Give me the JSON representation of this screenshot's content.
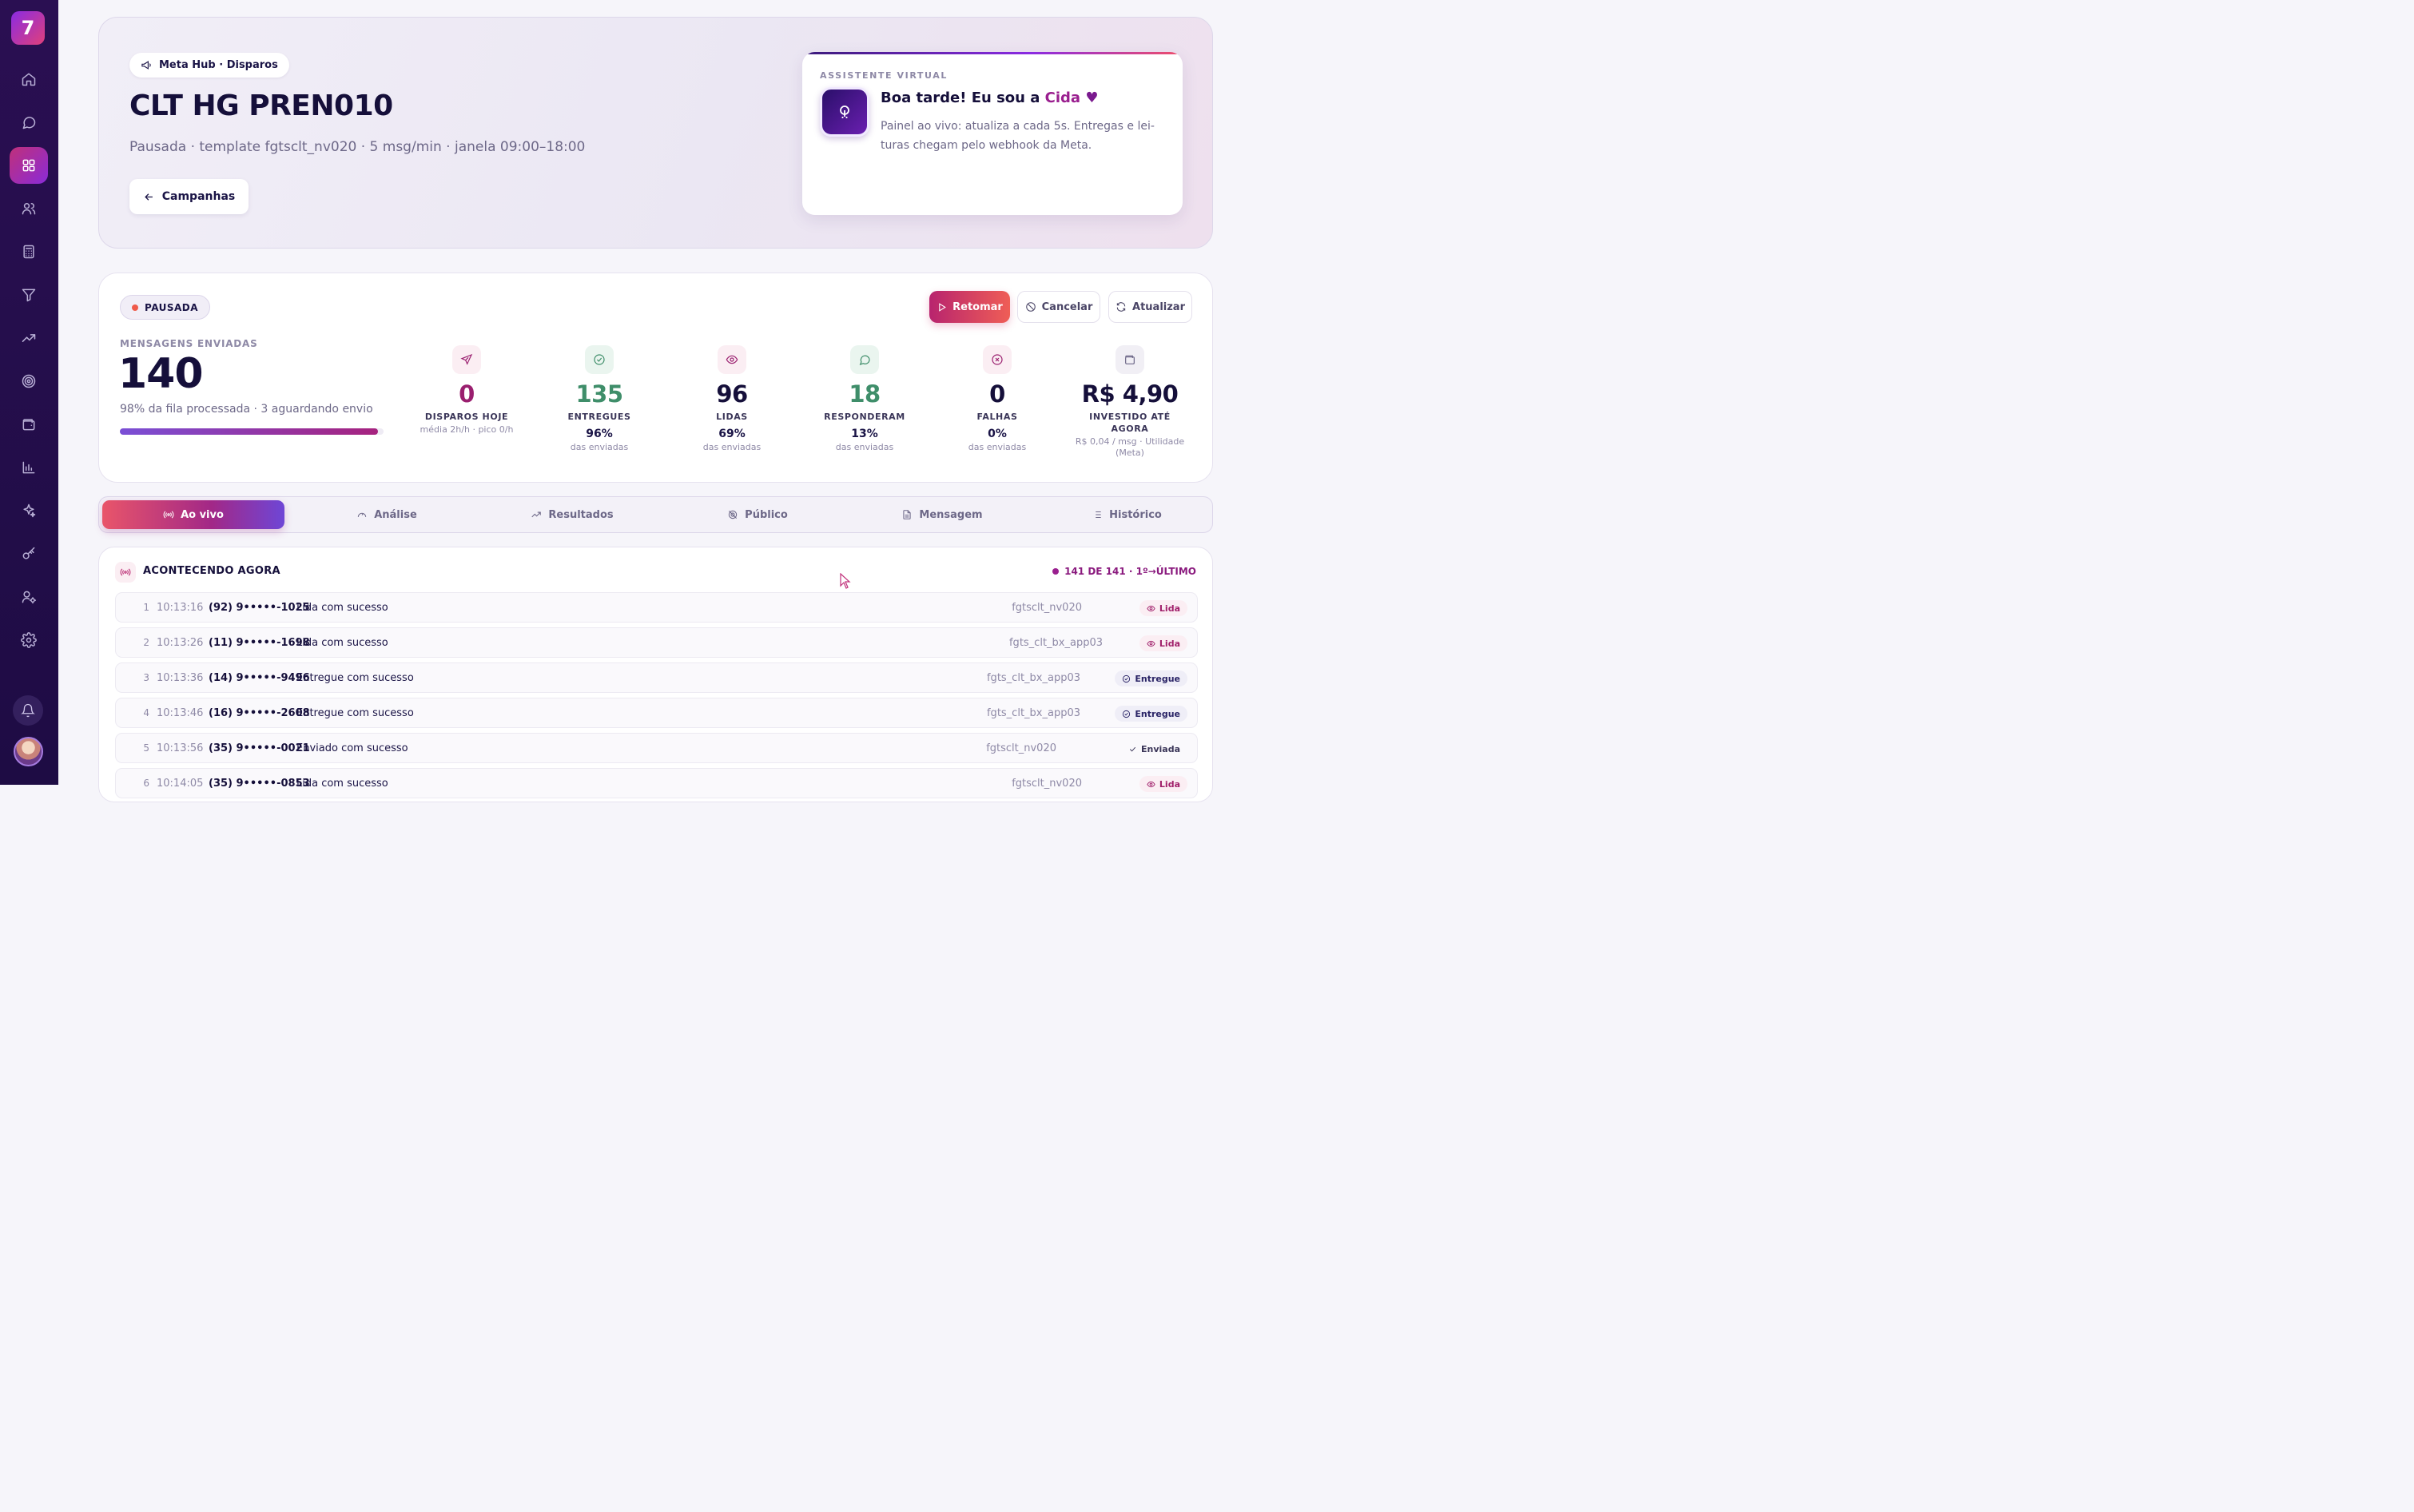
{
  "sidebar": {
    "logo": "7",
    "items": [
      "home",
      "chat",
      "dashboard",
      "users",
      "calculator",
      "filter",
      "trending",
      "target",
      "wallet",
      "bar-chart",
      "sparkles",
      "key",
      "user-settings",
      "settings"
    ],
    "active_index": 2
  },
  "hero": {
    "pill": "Meta Hub · Disparos",
    "title": "CLT HG PREN010",
    "subtitle": "Pausada · template fgtsclt_nv020 · 5 msg/min · janela 09:00–18:00",
    "back_button": "Campanhas"
  },
  "assistant": {
    "label": "ASSISTENTE VIRTUAL",
    "greeting": "Boa tarde! Eu sou a ",
    "name": "Cida",
    "heart": "♥",
    "text": "Painel ao vivo: atualiza a cada 5s. Entregas e lei­turas chegam pelo webhook da Meta."
  },
  "status": {
    "badge": "PAUSADA",
    "resume": "Retomar",
    "cancel": "Cancelar",
    "refresh": "Atualizar",
    "sent_label": "MENSAGENS ENVIADAS",
    "sent_value": "140",
    "sent_sub": "98% da fila processada · 3 aguardando envio",
    "progress": 0.98
  },
  "metrics": [
    {
      "value": "0",
      "label": "DISPAROS HOJE",
      "pct": "",
      "sub": "média 2h/h · pico 0/h",
      "color": "#9a1f6f",
      "icon": "send-icon",
      "bg": "#fbeef3",
      "stroke": "#9a1f6f"
    },
    {
      "value": "135",
      "label": "ENTREGUES",
      "pct": "96%",
      "sub": "das enviadas",
      "color": "#3f8e6a",
      "icon": "check-circle-icon",
      "bg": "#eaf5ef",
      "stroke": "#3f8e6a"
    },
    {
      "value": "96",
      "label": "LIDAS",
      "pct": "69%",
      "sub": "das enviadas",
      "color": "#150f3a",
      "icon": "eye-icon",
      "bg": "#fbeef3",
      "stroke": "#9a1f6f"
    },
    {
      "value": "18",
      "label": "RESPONDERAM",
      "pct": "13%",
      "sub": "das enviadas",
      "color": "#3f8e6a",
      "icon": "message-icon",
      "bg": "#eaf5ef",
      "stroke": "#3f8e6a"
    },
    {
      "value": "0",
      "label": "FALHAS",
      "pct": "0%",
      "sub": "das enviadas",
      "color": "#150f3a",
      "icon": "x-circle-icon",
      "bg": "#fbeef3",
      "stroke": "#9a1f6f"
    },
    {
      "value": "R$ 4,90",
      "label": "INVESTIDO ATÉ AGORA",
      "pct": "",
      "sub": "R$ 0,04 / msg · Utilidade (Meta)",
      "color": "#150f3a",
      "icon": "wallet-icon",
      "bg": "#f1eff5",
      "stroke": "#6d6888"
    }
  ],
  "tabs": [
    "Ao vivo",
    "Análise",
    "Resultados",
    "Público",
    "Mensagem",
    "Histórico"
  ],
  "feed": {
    "title": "ACONTECENDO AGORA",
    "counter": "141 DE 141 · 1º→ÚLTIMO",
    "rows": [
      {
        "n": "1",
        "time": "10:13:16",
        "phone": "(92) 9•••••-1025",
        "status_text": "Lida com sucesso",
        "template": "fgtsclt_nv020",
        "badge": "Lida",
        "kind": "lida"
      },
      {
        "n": "2",
        "time": "10:13:26",
        "phone": "(11) 9•••••-1698",
        "status_text": "Lida com sucesso",
        "template": "fgts_clt_bx_app03",
        "badge": "Lida",
        "kind": "lida"
      },
      {
        "n": "3",
        "time": "10:13:36",
        "phone": "(14) 9•••••-9496",
        "status_text": "Entregue com sucesso",
        "template": "fgts_clt_bx_app03",
        "badge": "Entregue",
        "kind": "entregue"
      },
      {
        "n": "4",
        "time": "10:13:46",
        "phone": "(16) 9•••••-2608",
        "status_text": "Entregue com sucesso",
        "template": "fgts_clt_bx_app03",
        "badge": "Entregue",
        "kind": "entregue"
      },
      {
        "n": "5",
        "time": "10:13:56",
        "phone": "(35) 9•••••-0021",
        "status_text": "Enviado com sucesso",
        "template": "fgtsclt_nv020",
        "badge": "Enviada",
        "kind": "enviada"
      },
      {
        "n": "6",
        "time": "10:14:05",
        "phone": "(35) 9•••••-0853",
        "status_text": "Lida com sucesso",
        "template": "fgtsclt_nv020",
        "badge": "Lida",
        "kind": "lida"
      }
    ]
  }
}
